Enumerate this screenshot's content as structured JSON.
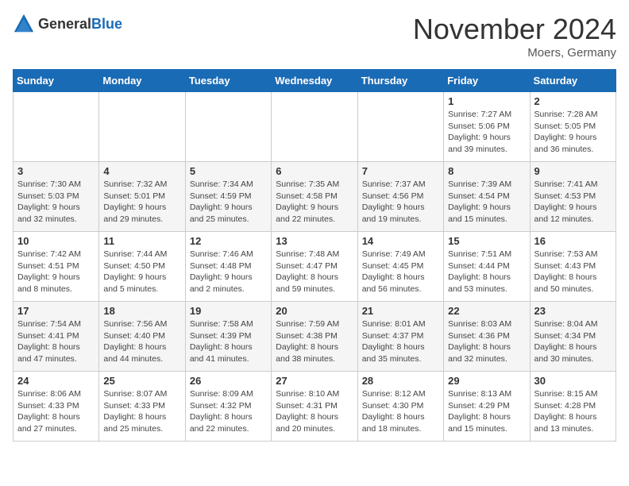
{
  "logo": {
    "general": "General",
    "blue": "Blue"
  },
  "header": {
    "month": "November 2024",
    "location": "Moers, Germany"
  },
  "weekdays": [
    "Sunday",
    "Monday",
    "Tuesday",
    "Wednesday",
    "Thursday",
    "Friday",
    "Saturday"
  ],
  "weeks": [
    [
      {
        "day": "",
        "info": ""
      },
      {
        "day": "",
        "info": ""
      },
      {
        "day": "",
        "info": ""
      },
      {
        "day": "",
        "info": ""
      },
      {
        "day": "",
        "info": ""
      },
      {
        "day": "1",
        "info": "Sunrise: 7:27 AM\nSunset: 5:06 PM\nDaylight: 9 hours\nand 39 minutes."
      },
      {
        "day": "2",
        "info": "Sunrise: 7:28 AM\nSunset: 5:05 PM\nDaylight: 9 hours\nand 36 minutes."
      }
    ],
    [
      {
        "day": "3",
        "info": "Sunrise: 7:30 AM\nSunset: 5:03 PM\nDaylight: 9 hours\nand 32 minutes."
      },
      {
        "day": "4",
        "info": "Sunrise: 7:32 AM\nSunset: 5:01 PM\nDaylight: 9 hours\nand 29 minutes."
      },
      {
        "day": "5",
        "info": "Sunrise: 7:34 AM\nSunset: 4:59 PM\nDaylight: 9 hours\nand 25 minutes."
      },
      {
        "day": "6",
        "info": "Sunrise: 7:35 AM\nSunset: 4:58 PM\nDaylight: 9 hours\nand 22 minutes."
      },
      {
        "day": "7",
        "info": "Sunrise: 7:37 AM\nSunset: 4:56 PM\nDaylight: 9 hours\nand 19 minutes."
      },
      {
        "day": "8",
        "info": "Sunrise: 7:39 AM\nSunset: 4:54 PM\nDaylight: 9 hours\nand 15 minutes."
      },
      {
        "day": "9",
        "info": "Sunrise: 7:41 AM\nSunset: 4:53 PM\nDaylight: 9 hours\nand 12 minutes."
      }
    ],
    [
      {
        "day": "10",
        "info": "Sunrise: 7:42 AM\nSunset: 4:51 PM\nDaylight: 9 hours\nand 8 minutes."
      },
      {
        "day": "11",
        "info": "Sunrise: 7:44 AM\nSunset: 4:50 PM\nDaylight: 9 hours\nand 5 minutes."
      },
      {
        "day": "12",
        "info": "Sunrise: 7:46 AM\nSunset: 4:48 PM\nDaylight: 9 hours\nand 2 minutes."
      },
      {
        "day": "13",
        "info": "Sunrise: 7:48 AM\nSunset: 4:47 PM\nDaylight: 8 hours\nand 59 minutes."
      },
      {
        "day": "14",
        "info": "Sunrise: 7:49 AM\nSunset: 4:45 PM\nDaylight: 8 hours\nand 56 minutes."
      },
      {
        "day": "15",
        "info": "Sunrise: 7:51 AM\nSunset: 4:44 PM\nDaylight: 8 hours\nand 53 minutes."
      },
      {
        "day": "16",
        "info": "Sunrise: 7:53 AM\nSunset: 4:43 PM\nDaylight: 8 hours\nand 50 minutes."
      }
    ],
    [
      {
        "day": "17",
        "info": "Sunrise: 7:54 AM\nSunset: 4:41 PM\nDaylight: 8 hours\nand 47 minutes."
      },
      {
        "day": "18",
        "info": "Sunrise: 7:56 AM\nSunset: 4:40 PM\nDaylight: 8 hours\nand 44 minutes."
      },
      {
        "day": "19",
        "info": "Sunrise: 7:58 AM\nSunset: 4:39 PM\nDaylight: 8 hours\nand 41 minutes."
      },
      {
        "day": "20",
        "info": "Sunrise: 7:59 AM\nSunset: 4:38 PM\nDaylight: 8 hours\nand 38 minutes."
      },
      {
        "day": "21",
        "info": "Sunrise: 8:01 AM\nSunset: 4:37 PM\nDaylight: 8 hours\nand 35 minutes."
      },
      {
        "day": "22",
        "info": "Sunrise: 8:03 AM\nSunset: 4:36 PM\nDaylight: 8 hours\nand 32 minutes."
      },
      {
        "day": "23",
        "info": "Sunrise: 8:04 AM\nSunset: 4:34 PM\nDaylight: 8 hours\nand 30 minutes."
      }
    ],
    [
      {
        "day": "24",
        "info": "Sunrise: 8:06 AM\nSunset: 4:33 PM\nDaylight: 8 hours\nand 27 minutes."
      },
      {
        "day": "25",
        "info": "Sunrise: 8:07 AM\nSunset: 4:33 PM\nDaylight: 8 hours\nand 25 minutes."
      },
      {
        "day": "26",
        "info": "Sunrise: 8:09 AM\nSunset: 4:32 PM\nDaylight: 8 hours\nand 22 minutes."
      },
      {
        "day": "27",
        "info": "Sunrise: 8:10 AM\nSunset: 4:31 PM\nDaylight: 8 hours\nand 20 minutes."
      },
      {
        "day": "28",
        "info": "Sunrise: 8:12 AM\nSunset: 4:30 PM\nDaylight: 8 hours\nand 18 minutes."
      },
      {
        "day": "29",
        "info": "Sunrise: 8:13 AM\nSunset: 4:29 PM\nDaylight: 8 hours\nand 15 minutes."
      },
      {
        "day": "30",
        "info": "Sunrise: 8:15 AM\nSunset: 4:28 PM\nDaylight: 8 hours\nand 13 minutes."
      }
    ]
  ]
}
